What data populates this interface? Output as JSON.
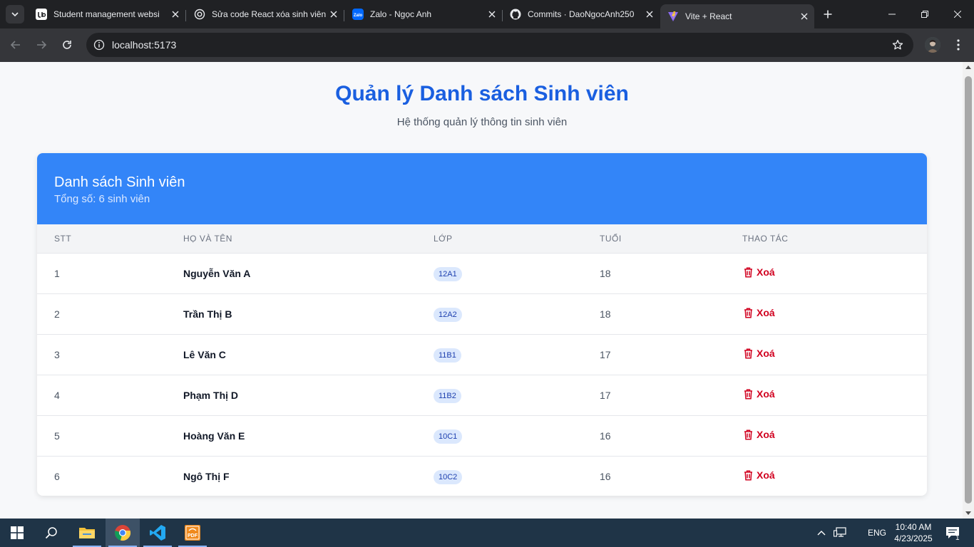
{
  "browser": {
    "tabs": [
      {
        "title": "Student management websi",
        "icon": "udemy-icon"
      },
      {
        "title": "Sửa code React xóa sinh viên",
        "icon": "chatgpt-icon"
      },
      {
        "title": "Zalo - Ngọc Anh",
        "icon": "zalo-icon"
      },
      {
        "title": "Commits · DaoNgocAnh250",
        "icon": "github-icon"
      },
      {
        "title": "Vite + React",
        "icon": "vite-icon"
      }
    ],
    "url": "localhost:5173"
  },
  "page": {
    "title": "Quản lý Danh sách Sinh viên",
    "subtitle": "Hệ thống quản lý thông tin sinh viên",
    "card_title": "Danh sách Sinh viên",
    "card_count": "Tổng số: 6 sinh viên",
    "columns": [
      "STT",
      "Họ và tên",
      "Lớp",
      "Tuổi",
      "Thao tác"
    ],
    "delete_label": "Xoá",
    "students": [
      {
        "stt": "1",
        "name": "Nguyễn Văn A",
        "class": "12A1",
        "age": "18"
      },
      {
        "stt": "2",
        "name": "Trần Thị B",
        "class": "12A2",
        "age": "18"
      },
      {
        "stt": "3",
        "name": "Lê Văn C",
        "class": "11B1",
        "age": "17"
      },
      {
        "stt": "4",
        "name": "Phạm Thị D",
        "class": "11B2",
        "age": "17"
      },
      {
        "stt": "5",
        "name": "Hoàng Văn E",
        "class": "10C1",
        "age": "16"
      },
      {
        "stt": "6",
        "name": "Ngô Thị F",
        "class": "10C2",
        "age": "16"
      }
    ]
  },
  "taskbar": {
    "language": "ENG",
    "time": "10:40 AM",
    "date": "4/23/2025",
    "notification_count": "1"
  },
  "colors": {
    "accent": "#1a5fe0",
    "card_header": "#3385f8",
    "delete": "#d1001f",
    "badge_bg": "#dbe8fd"
  }
}
